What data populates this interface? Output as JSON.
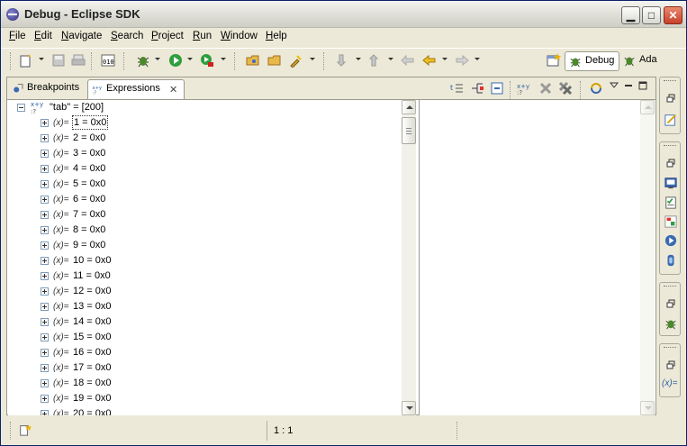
{
  "window": {
    "title": "Debug - Eclipse SDK"
  },
  "menu": [
    {
      "u": "F",
      "rest": "ile"
    },
    {
      "u": "E",
      "rest": "dit"
    },
    {
      "u": "N",
      "rest": "avigate"
    },
    {
      "u": "S",
      "rest": "earch"
    },
    {
      "u": "P",
      "rest": "roject"
    },
    {
      "u": "R",
      "rest": "un"
    },
    {
      "u": "W",
      "rest": "indow"
    },
    {
      "u": "H",
      "rest": "elp"
    }
  ],
  "perspectives": {
    "active": "Debug",
    "other": "Ada"
  },
  "tabs": {
    "breakpoints": "Breakpoints",
    "expressions": "Expressions"
  },
  "tree": {
    "root": "\"tab\" = [200]",
    "var_icon": "(x)=",
    "items": [
      "1 = 0x0",
      "2 = 0x0",
      "3 = 0x0",
      "4 = 0x0",
      "5 = 0x0",
      "6 = 0x0",
      "7 = 0x0",
      "8 = 0x0",
      "9 = 0x0",
      "10 = 0x0",
      "11 = 0x0",
      "12 = 0x0",
      "13 = 0x0",
      "14 = 0x0",
      "15 = 0x0",
      "16 = 0x0",
      "17 = 0x0",
      "18 = 0x0",
      "19 = 0x0",
      "20 = 0x0"
    ]
  },
  "status": {
    "position": "1 : 1"
  },
  "icons": {
    "expression_view": "x+y-icon",
    "variable": "variable-icon"
  },
  "colors": {
    "title_bar": "#dcdcd4",
    "close_button": "#c8402a",
    "selection_border": "#7f9db9"
  }
}
